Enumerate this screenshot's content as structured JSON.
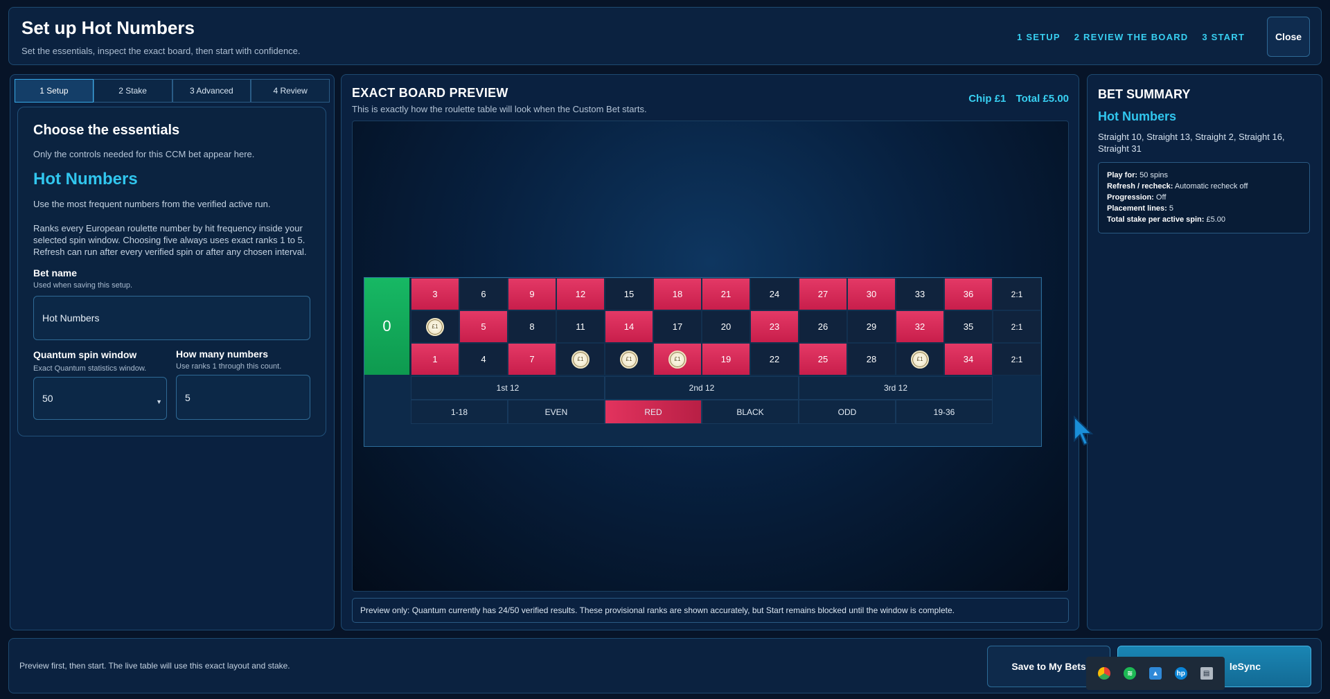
{
  "header": {
    "title": "Set up Hot Numbers",
    "subtitle": "Set the essentials, inspect the exact board, then start with confidence.",
    "steps": [
      "1 SETUP",
      "2 REVIEW THE BOARD",
      "3 START"
    ],
    "close_label": "Close"
  },
  "tabs": [
    "1 Setup",
    "2 Stake",
    "3 Advanced",
    "4 Review"
  ],
  "essentials": {
    "heading": "Choose the essentials",
    "subheading": "Only the controls needed for this CCM bet appear here.",
    "bet_title": "Hot Numbers",
    "description1": "Use the most frequent numbers from the verified active run.",
    "description2": "Ranks every European roulette number by hit frequency inside your selected spin window. Choosing five always uses exact ranks 1 to 5. Refresh can run after every verified spin or after any chosen interval.",
    "bet_name_label": "Bet name",
    "bet_name_hint": "Used when saving this setup.",
    "bet_name_value": "Hot Numbers",
    "window_label": "Quantum spin window",
    "window_hint": "Exact Quantum statistics window.",
    "window_value": "50",
    "count_label": "How many numbers",
    "count_hint": "Use ranks 1 through this count.",
    "count_value": "5"
  },
  "preview": {
    "heading": "EXACT BOARD PREVIEW",
    "subheading": "This is exactly how the roulette table will look when the Custom Bet starts.",
    "chip": "Chip £1",
    "total": "Total £5.00",
    "notice": "Preview only: Quantum currently has 24/50 verified results. These provisional ranks are shown accurately, but Start remains blocked until the window is complete."
  },
  "board": {
    "zero": "0",
    "top_row": [
      "3",
      "6",
      "9",
      "12",
      "15",
      "18",
      "21",
      "24",
      "27",
      "30",
      "33",
      "36"
    ],
    "mid_row": [
      "2",
      "5",
      "8",
      "11",
      "14",
      "17",
      "20",
      "23",
      "26",
      "29",
      "32",
      "35"
    ],
    "bottom_row": [
      "1",
      "4",
      "7",
      "10",
      "13",
      "16",
      "19",
      "22",
      "25",
      "28",
      "31",
      "34"
    ],
    "column_label": "2:1",
    "dozens": [
      "1st 12",
      "2nd 12",
      "3rd 12"
    ],
    "outside": [
      "1-18",
      "EVEN",
      "RED",
      "BLACK",
      "ODD",
      "19-36"
    ],
    "chip_label": "£1",
    "chips_on": [
      "2",
      "10",
      "13",
      "16",
      "31"
    ],
    "red_numbers": [
      "1",
      "3",
      "5",
      "7",
      "9",
      "12",
      "14",
      "16",
      "18",
      "19",
      "21",
      "23",
      "25",
      "27",
      "30",
      "32",
      "34",
      "36"
    ]
  },
  "summary": {
    "heading": "BET SUMMARY",
    "bet_name": "Hot Numbers",
    "bets": "Straight 10, Straight 13, Straight 2, Straight 16, Straight 31",
    "details": [
      {
        "label": "Play for:",
        "value": "50 spins"
      },
      {
        "label": "Refresh / recheck:",
        "value": "Automatic recheck off"
      },
      {
        "label": "Progression:",
        "value": "Off"
      },
      {
        "label": "Placement lines:",
        "value": "5"
      },
      {
        "label": "Total stake per active spin:",
        "value": "£5.00"
      }
    ]
  },
  "footer": {
    "note": "Preview first, then start. The live table will use this exact layout and stake.",
    "save_label": "Save to My Bets",
    "start_label": "leSync"
  },
  "tray": [
    "chrome-icon",
    "spotify-icon",
    "defender-icon",
    "hp-icon",
    "chat-icon"
  ],
  "colors": {
    "accent": "#31c6ee",
    "red": "#d8285a",
    "green": "#12a857",
    "panel": "#0a2140"
  }
}
